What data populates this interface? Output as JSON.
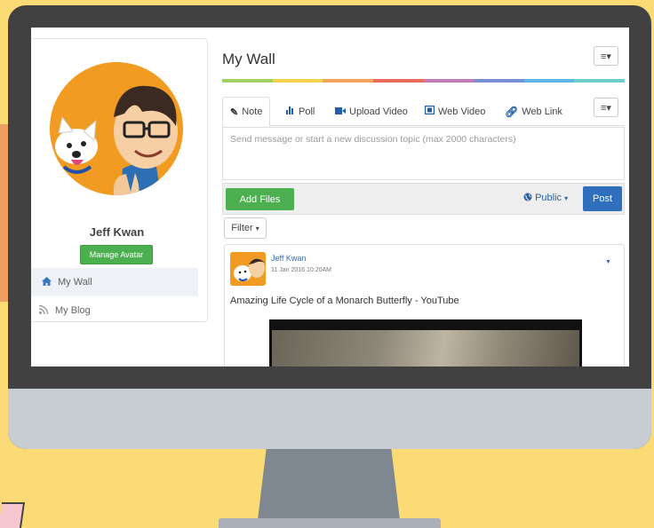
{
  "profile": {
    "name": "Jeff Kwan",
    "manage_avatar_label": "Manage Avatar"
  },
  "sidebar": {
    "items": [
      {
        "label": "My Wall",
        "icon": "home-icon",
        "active": true
      },
      {
        "label": "My Blog",
        "icon": "rss-icon",
        "active": false
      }
    ]
  },
  "main": {
    "title": "My Wall",
    "menu_glyph": "≡▾",
    "rainbow_colors": [
      "#a3d063",
      "#f6d24e",
      "#f2a45c",
      "#e76c5a",
      "#c77ab9",
      "#7b8fd6",
      "#5db5e8",
      "#6ed0c8"
    ]
  },
  "composer": {
    "tabs": [
      {
        "label": "Note",
        "icon": "edit-icon",
        "glyph": "✎"
      },
      {
        "label": "Poll",
        "icon": "bar-chart-icon",
        "glyph": "▮"
      },
      {
        "label": "Upload Video",
        "icon": "video-camera-icon",
        "glyph": "■"
      },
      {
        "label": "Web Video",
        "icon": "film-icon",
        "glyph": "▣"
      },
      {
        "label": "Web Link",
        "icon": "link-icon",
        "glyph": "⚭"
      }
    ],
    "placeholder": "Send message or start a new discussion topic (max 2000 characters)",
    "add_files_label": "Add Files",
    "visibility_label": "Public",
    "visibility_glyph": "🌐",
    "post_label": "Post"
  },
  "feed": {
    "filter_label": "Filter",
    "posts": [
      {
        "author": "Jeff Kwan",
        "date": "11 Jan 2016 10:20AM",
        "title": "Amazing Life Cycle of a Monarch Butterfly - YouTube"
      }
    ]
  },
  "colors": {
    "accent_blue": "#2f6fbd",
    "accent_green": "#4caf50",
    "background": "#fadb75"
  }
}
